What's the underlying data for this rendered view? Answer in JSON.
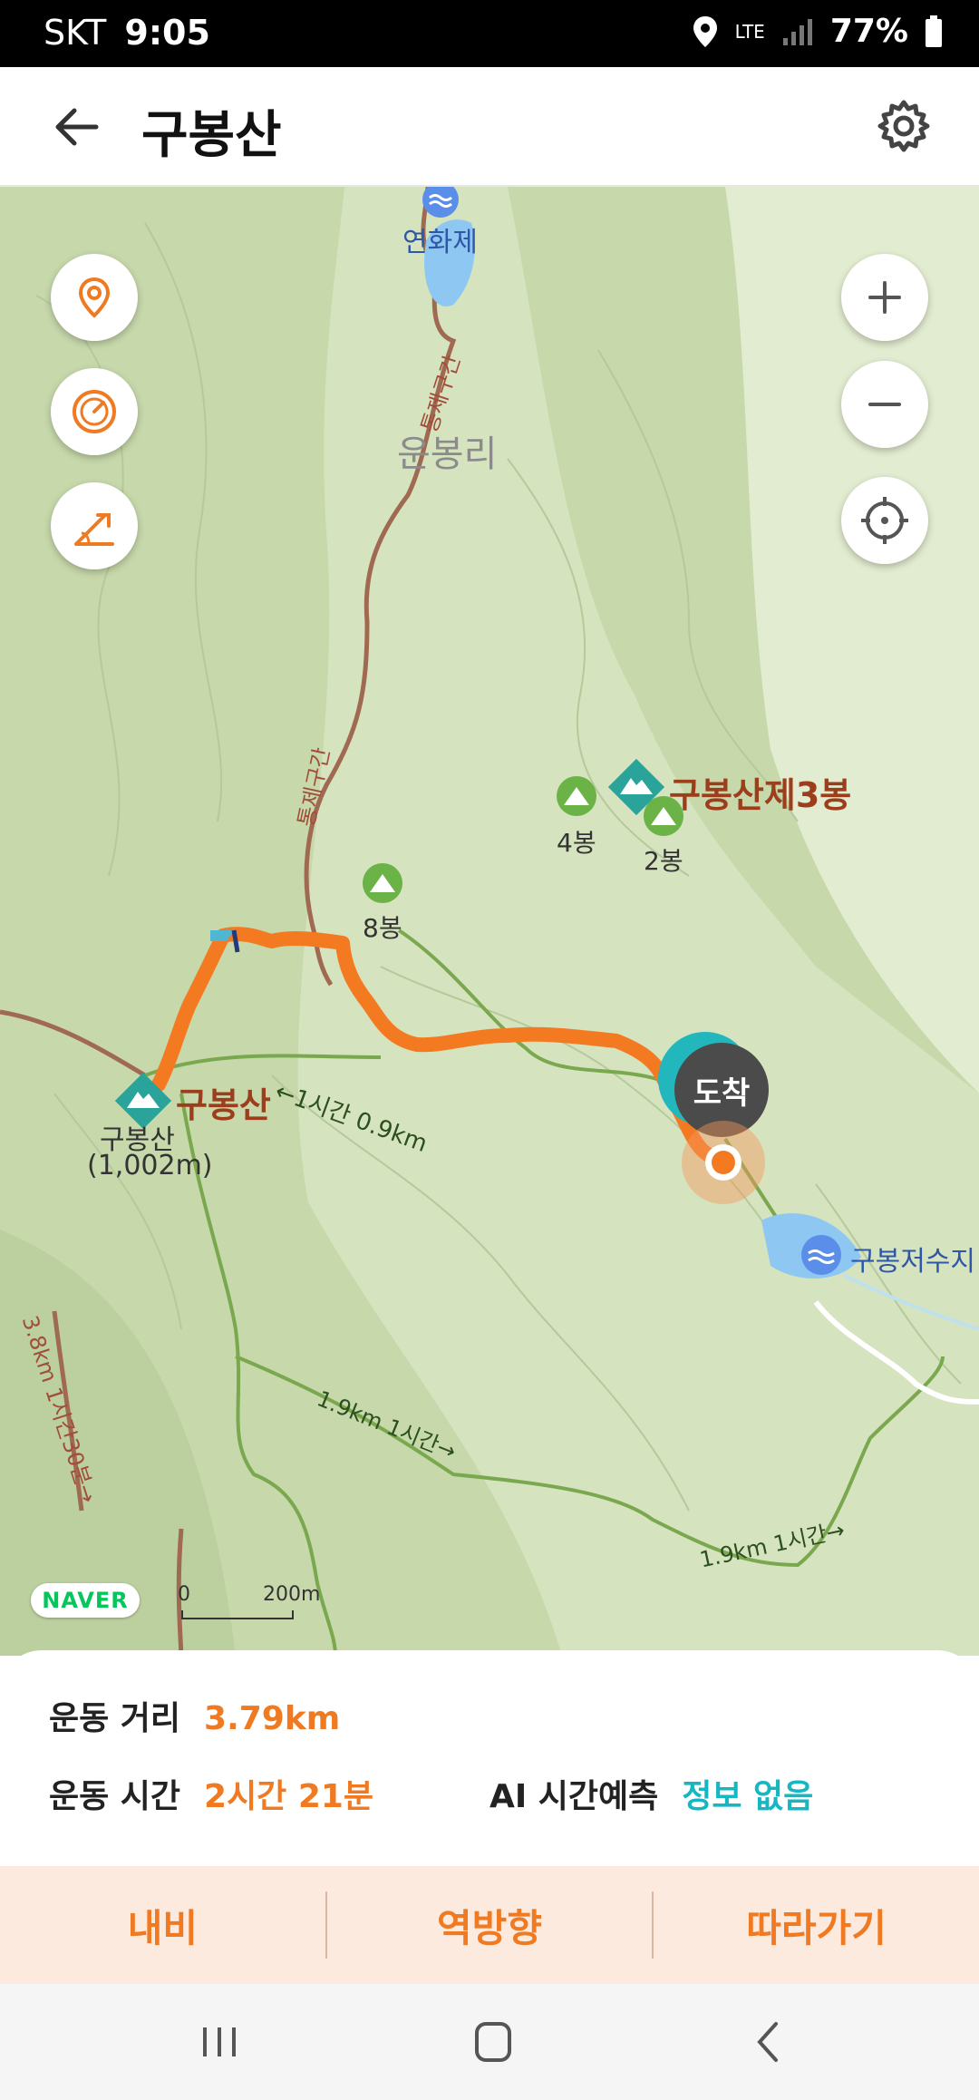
{
  "status": {
    "carrier": "SKT",
    "time": "9:05",
    "network": "LTE",
    "battery": "77%"
  },
  "header": {
    "title": "구봉산"
  },
  "map": {
    "places": {
      "yeonhwaje": "연화제",
      "unbongri": "운봉리",
      "control_zone_1": "통제구간",
      "control_zone_2": "통제구간",
      "peak3": "구봉산제3봉",
      "peak4": "4봉",
      "peak2": "2봉",
      "peak8": "8봉",
      "gubongsan": "구봉산",
      "gubongsan_name": "구봉산",
      "gubongsan_elev": "(1,002m)",
      "reservoir": "구봉저수지",
      "trail1": "←1시간 0.9km",
      "trail2": "1.9km 1시간→",
      "trail3": "1.9km 1시간→",
      "trail4": "3.8km 1시간30분→",
      "arrival": "도착"
    },
    "naver_logo": "NAVER",
    "scale": {
      "zero": "0",
      "distance": "200m"
    }
  },
  "stats": {
    "distance_label": "운동 거리",
    "distance_value": "3.79km",
    "time_label": "운동 시간",
    "time_value": "2시간 21분",
    "ai_label": "AI 시간예측",
    "ai_value": "정보 없음"
  },
  "actions": {
    "navi": "내비",
    "reverse": "역방향",
    "follow": "따라가기"
  },
  "colors": {
    "accent": "#f07a22",
    "teal": "#14b7c2",
    "map_bg": "#c9d9ad"
  }
}
